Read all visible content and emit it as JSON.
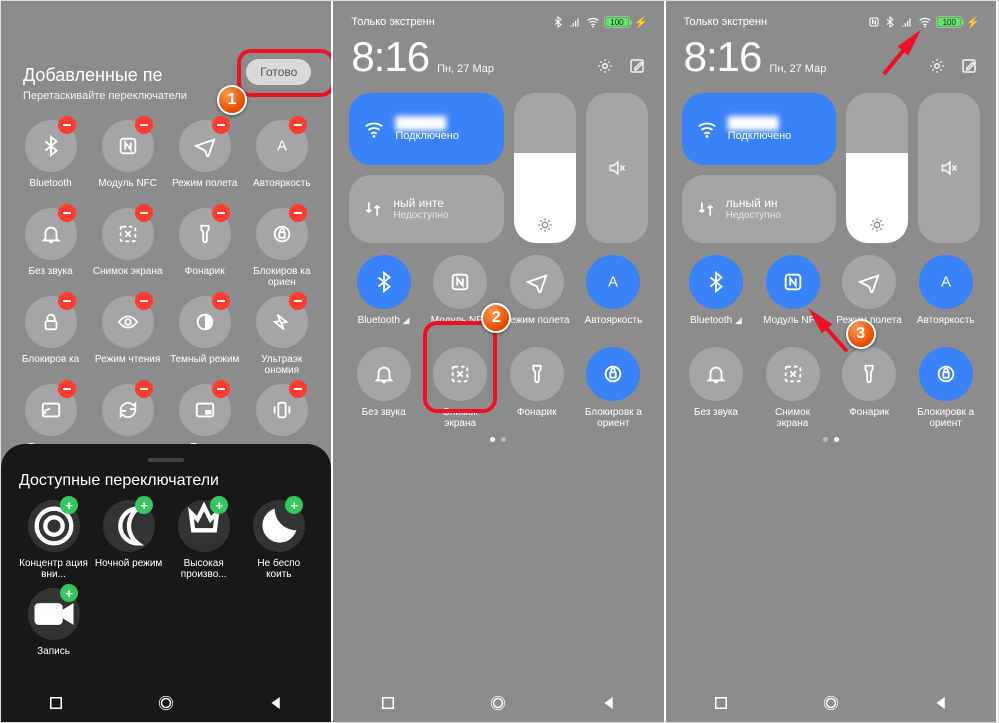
{
  "markers": {
    "m1": "1",
    "m2": "2",
    "m3": "3"
  },
  "p1": {
    "title": "Добавленные пе",
    "subtitle": "Перетаскивайте переключатели",
    "done": "Готово",
    "tiles": [
      {
        "label": "Bluetooth",
        "icon": "bluetooth"
      },
      {
        "label": "Модуль NFC",
        "icon": "nfc"
      },
      {
        "label": "Режим полета",
        "icon": "airplane"
      },
      {
        "label": "Автояркость",
        "icon": "auto"
      },
      {
        "label": "Без звука",
        "icon": "bell"
      },
      {
        "label": "Снимок экрана",
        "icon": "screenshot"
      },
      {
        "label": "Фонарик",
        "icon": "torch"
      },
      {
        "label": "Блокиров ка ориен",
        "icon": "lock-rot"
      },
      {
        "label": "Блокиров ка",
        "icon": "lock"
      },
      {
        "label": "Режим чтения",
        "icon": "eye"
      },
      {
        "label": "Темный режим",
        "icon": "dark"
      },
      {
        "label": "Ультраэк ономия",
        "icon": "power"
      },
      {
        "label": "Трансляц",
        "icon": "cast"
      },
      {
        "label": "",
        "icon": "sync"
      },
      {
        "label": "Плава",
        "icon": "pip"
      },
      {
        "label": "",
        "icon": "vibrate"
      }
    ],
    "panel_title": "Доступные переключатели",
    "avail": [
      {
        "label": "Концентр ация вни...",
        "icon": "focus"
      },
      {
        "label": "Ночной режим",
        "icon": "night"
      },
      {
        "label": "Высокая произво...",
        "icon": "perf"
      },
      {
        "label": "Не беспо коить",
        "icon": "dnd"
      },
      {
        "label": "Запись",
        "icon": "record"
      }
    ]
  },
  "p2": {
    "status_left": "Только экстренн",
    "battery": "100",
    "time": "8:16",
    "date": "Пн, 27 Мар",
    "wifi_sub": "Подключено",
    "data_line1a": "ный инте",
    "data_line1b": "льный ин",
    "data_line2": "Недоступно",
    "tiles": [
      {
        "label": "Bluetooth",
        "icon": "bluetooth",
        "on": true,
        "sub": "◢"
      },
      {
        "label": "Модуль NFC",
        "icon": "nfc",
        "on": false
      },
      {
        "label": "Режим полета",
        "icon": "airplane",
        "on": false
      },
      {
        "label": "Автояркость",
        "icon": "auto",
        "on": true
      },
      {
        "label": "Без звука",
        "icon": "bell",
        "on": false
      },
      {
        "label": "Снимок экрана",
        "icon": "screenshot",
        "on": false
      },
      {
        "label": "Фонарик",
        "icon": "torch",
        "on": false
      },
      {
        "label": "Блокировк а ориент",
        "icon": "lock-rot",
        "on": true
      }
    ]
  },
  "p3": {
    "tiles": [
      {
        "label": "Bluetooth",
        "icon": "bluetooth",
        "on": true,
        "sub": "◢"
      },
      {
        "label": "Модуль NFC",
        "icon": "nfc",
        "on": true
      },
      {
        "label": "Режим полета",
        "icon": "airplane",
        "on": false
      },
      {
        "label": "Автояркость",
        "icon": "auto",
        "on": true
      },
      {
        "label": "Без звука",
        "icon": "bell",
        "on": false
      },
      {
        "label": "Снимок экрана",
        "icon": "screenshot",
        "on": false
      },
      {
        "label": "Фонарик",
        "icon": "torch",
        "on": false
      },
      {
        "label": "Блокировк а ориент",
        "icon": "lock-rot",
        "on": true
      }
    ]
  }
}
